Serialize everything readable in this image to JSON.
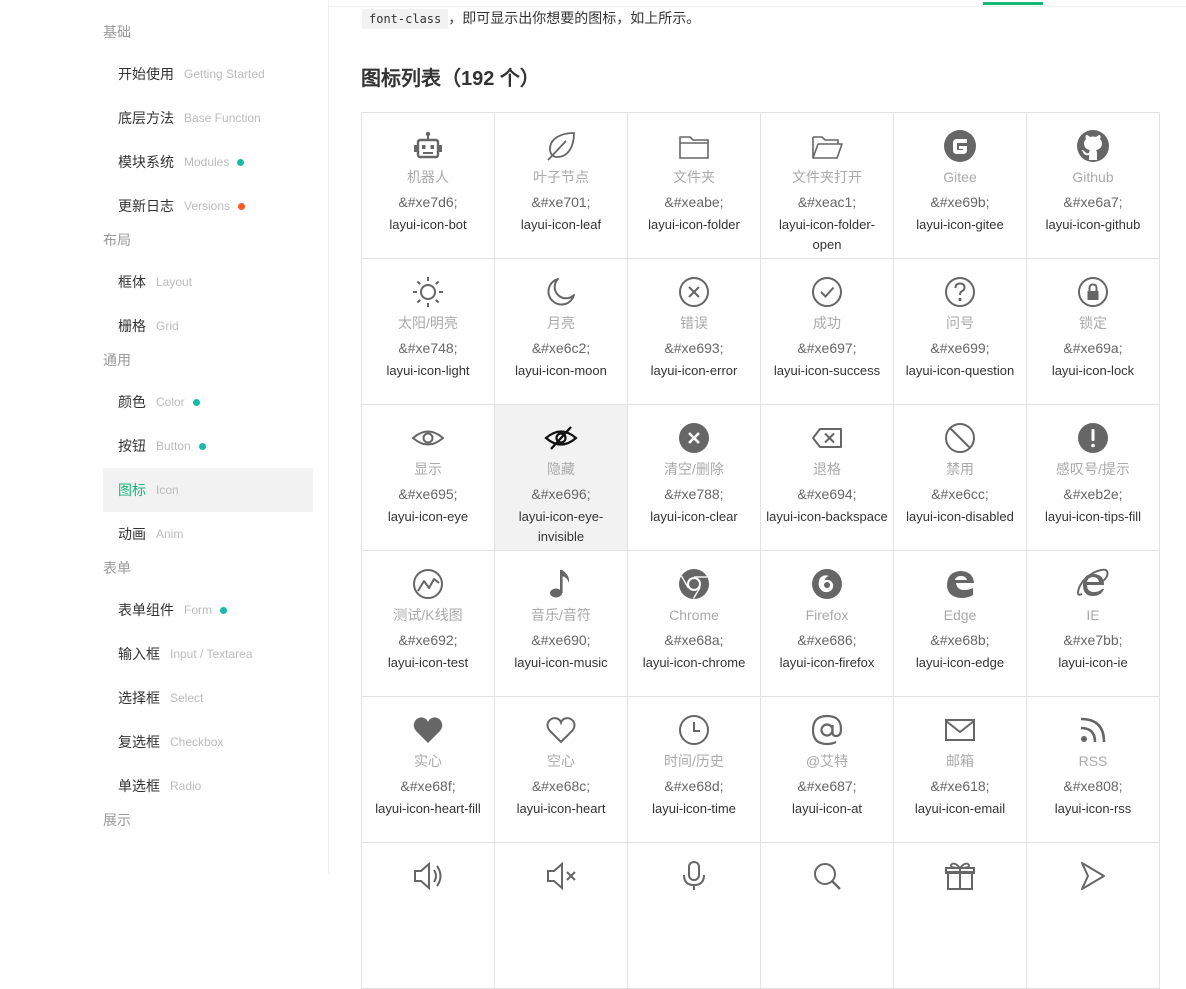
{
  "sidebar": {
    "groups": [
      {
        "title": "基础",
        "items": [
          {
            "zh": "开始使用",
            "en": "Getting Started"
          },
          {
            "zh": "底层方法",
            "en": "Base Function"
          },
          {
            "zh": "模块系统",
            "en": "Modules",
            "dot": "#16baaa"
          },
          {
            "zh": "更新日志",
            "en": "Versions",
            "dot": "#ff5722"
          }
        ]
      },
      {
        "title": "布局",
        "items": [
          {
            "zh": "框体",
            "en": "Layout"
          },
          {
            "zh": "栅格",
            "en": "Grid"
          }
        ]
      },
      {
        "title": "通用",
        "items": [
          {
            "zh": "颜色",
            "en": "Color",
            "dot": "#16baaa"
          },
          {
            "zh": "按钮",
            "en": "Button",
            "dot": "#16baaa"
          },
          {
            "zh": "图标",
            "en": "Icon",
            "active": true
          },
          {
            "zh": "动画",
            "en": "Anim"
          }
        ]
      },
      {
        "title": "表单",
        "items": [
          {
            "zh": "表单组件",
            "en": "Form",
            "dot": "#16baaa"
          },
          {
            "zh": "输入框",
            "en": "Input / Textarea"
          },
          {
            "zh": "选择框",
            "en": "Select"
          },
          {
            "zh": "复选框",
            "en": "Checkbox"
          },
          {
            "zh": "单选框",
            "en": "Radio"
          }
        ]
      },
      {
        "title": "展示",
        "items": []
      }
    ]
  },
  "main": {
    "intro_code": "font-class",
    "intro_text": "，即可显示出你想要的图标，如上所示。",
    "section_title": "图标列表（192 个）",
    "hover_index": 13,
    "accent_color": "#16b777",
    "icons": [
      {
        "icon": "robot-icon",
        "name": "机器人",
        "code": "&#xe7d6;",
        "cls": "layui-icon-bot"
      },
      {
        "icon": "leaf-icon",
        "name": "叶子节点",
        "code": "&#xe701;",
        "cls": "layui-icon-leaf"
      },
      {
        "icon": "folder-icon",
        "name": "文件夹",
        "code": "&#xeabe;",
        "cls": "layui-icon-folder"
      },
      {
        "icon": "folder-open-icon",
        "name": "文件夹打开",
        "code": "&#xeac1;",
        "cls": "layui-icon-folder-open"
      },
      {
        "icon": "gitee-icon",
        "name": "Gitee",
        "code": "&#xe69b;",
        "cls": "layui-icon-gitee"
      },
      {
        "icon": "github-icon",
        "name": "Github",
        "code": "&#xe6a7;",
        "cls": "layui-icon-github"
      },
      {
        "icon": "sun-icon",
        "name": "太阳/明亮",
        "code": "&#xe748;",
        "cls": "layui-icon-light"
      },
      {
        "icon": "moon-icon",
        "name": "月亮",
        "code": "&#xe6c2;",
        "cls": "layui-icon-moon"
      },
      {
        "icon": "error-icon",
        "name": "错误",
        "code": "&#xe693;",
        "cls": "layui-icon-error"
      },
      {
        "icon": "success-icon",
        "name": "成功",
        "code": "&#xe697;",
        "cls": "layui-icon-success"
      },
      {
        "icon": "question-icon",
        "name": "问号",
        "code": "&#xe699;",
        "cls": "layui-icon-question"
      },
      {
        "icon": "lock-icon",
        "name": "锁定",
        "code": "&#xe69a;",
        "cls": "layui-icon-lock"
      },
      {
        "icon": "eye-icon",
        "name": "显示",
        "code": "&#xe695;",
        "cls": "layui-icon-eye"
      },
      {
        "icon": "eye-invisible-icon",
        "name": "隐藏",
        "code": "&#xe696;",
        "cls": "layui-icon-eye-invisible"
      },
      {
        "icon": "clear-icon",
        "name": "清空/删除",
        "code": "&#xe788;",
        "cls": "layui-icon-clear"
      },
      {
        "icon": "backspace-icon",
        "name": "退格",
        "code": "&#xe694;",
        "cls": "layui-icon-backspace"
      },
      {
        "icon": "disabled-icon",
        "name": "禁用",
        "code": "&#xe6cc;",
        "cls": "layui-icon-disabled"
      },
      {
        "icon": "tips-fill-icon",
        "name": "感叹号/提示",
        "code": "&#xeb2e;",
        "cls": "layui-icon-tips-fill"
      },
      {
        "icon": "test-chart-icon",
        "name": "测试/K线图",
        "code": "&#xe692;",
        "cls": "layui-icon-test"
      },
      {
        "icon": "music-icon",
        "name": "音乐/音符",
        "code": "&#xe690;",
        "cls": "layui-icon-music"
      },
      {
        "icon": "chrome-icon",
        "name": "Chrome",
        "code": "&#xe68a;",
        "cls": "layui-icon-chrome"
      },
      {
        "icon": "firefox-icon",
        "name": "Firefox",
        "code": "&#xe686;",
        "cls": "layui-icon-firefox"
      },
      {
        "icon": "edge-icon",
        "name": "Edge",
        "code": "&#xe68b;",
        "cls": "layui-icon-edge"
      },
      {
        "icon": "ie-icon",
        "name": "IE",
        "code": "&#xe7bb;",
        "cls": "layui-icon-ie"
      },
      {
        "icon": "heart-fill-icon",
        "name": "实心",
        "code": "&#xe68f;",
        "cls": "layui-icon-heart-fill"
      },
      {
        "icon": "heart-icon",
        "name": "空心",
        "code": "&#xe68c;",
        "cls": "layui-icon-heart"
      },
      {
        "icon": "clock-icon",
        "name": "时间/历史",
        "code": "&#xe68d;",
        "cls": "layui-icon-time"
      },
      {
        "icon": "at-icon",
        "name": "@艾特",
        "code": "&#xe687;",
        "cls": "layui-icon-at"
      },
      {
        "icon": "email-icon",
        "name": "邮箱",
        "code": "&#xe618;",
        "cls": "layui-icon-email"
      },
      {
        "icon": "rss-icon",
        "name": "RSS",
        "code": "&#xe808;",
        "cls": "layui-icon-rss"
      },
      {
        "icon": "volume-icon",
        "name": "",
        "code": "",
        "cls": ""
      },
      {
        "icon": "mute-icon",
        "name": "",
        "code": "",
        "cls": ""
      },
      {
        "icon": "microphone-icon",
        "name": "",
        "code": "",
        "cls": ""
      },
      {
        "icon": "search-icon",
        "name": "",
        "code": "",
        "cls": ""
      },
      {
        "icon": "gift-icon",
        "name": "",
        "code": "",
        "cls": ""
      },
      {
        "icon": "share-icon",
        "name": "",
        "code": "",
        "cls": ""
      }
    ]
  }
}
